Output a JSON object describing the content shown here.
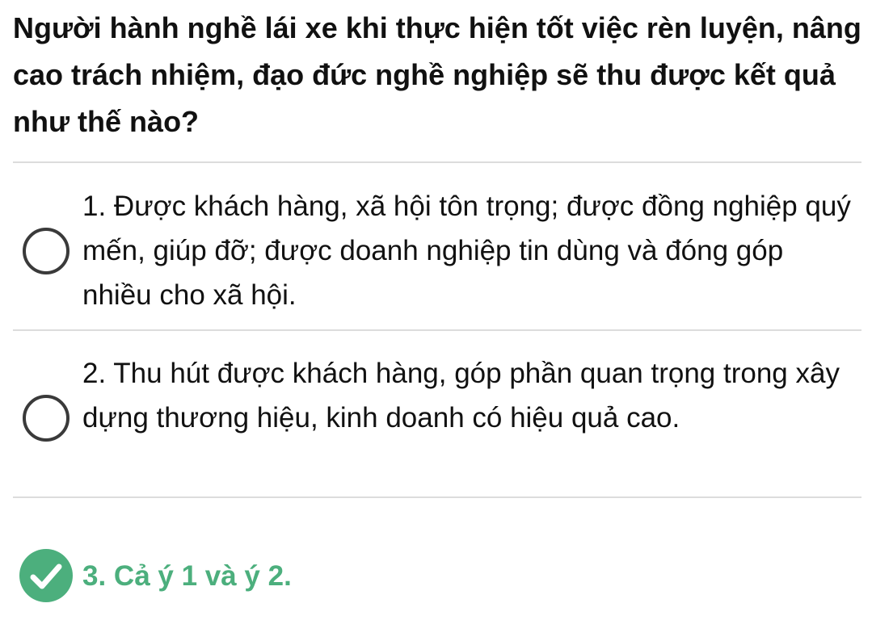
{
  "question": {
    "text": "Người hành nghề lái xe khi thực hiện tốt việc rèn luyện, nâng cao trách nhiệm, đạo đức nghề nghiệp sẽ thu được kết quả như thế nào?"
  },
  "options": [
    {
      "text": "1. Được khách hàng, xã hội tôn trọng; được đồng nghiệp quý mến, giúp đỡ; được doanh nghiệp tin dùng và đóng góp nhiều cho xã hội.",
      "state": "unselected"
    },
    {
      "text": "2. Thu hút được khách hàng, góp phần quan trọng trong xây dựng thương hiệu, kinh doanh có hiệu quả cao.",
      "state": "unselected"
    },
    {
      "text": "3. Cả ý 1 và ý 2.",
      "state": "correct"
    }
  ],
  "colors": {
    "correct": "#4caf7d",
    "radio_border": "#3a3a3a",
    "divider": "#dcdcdc"
  },
  "icons": {
    "unselected": "radio-empty-icon",
    "correct": "check-circle-icon"
  }
}
